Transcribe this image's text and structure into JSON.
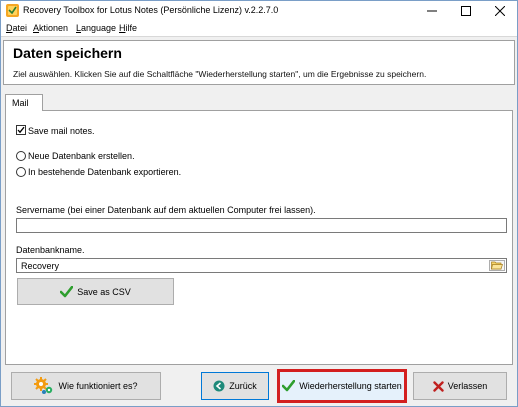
{
  "window": {
    "title": "Recovery Toolbox for Lotus Notes (Persönliche Lizenz) v.2.2.7.0",
    "controls": {
      "minimize": "–",
      "maximize": "☐",
      "close": "✕"
    }
  },
  "menu": [
    {
      "label_u": "D",
      "label_rest": "atei"
    },
    {
      "label_u": "A",
      "label_rest": "ktionen"
    },
    {
      "label_u": "L",
      "label_rest": "anguage"
    },
    {
      "label_u": "H",
      "label_rest": "ilfe"
    }
  ],
  "header": {
    "title": "Daten speichern",
    "subtitle": "Ziel auswählen. Klicken Sie auf die Schaltfläche \"Wiederherstellung starten\", um die Ergebnisse zu speichern."
  },
  "tabs": [
    {
      "label": "Mail"
    }
  ],
  "form": {
    "save_mail_notes": {
      "label": "Save mail notes.",
      "checked": true
    },
    "radio_new_db": {
      "label": "Neue Datenbank erstellen.",
      "selected": false
    },
    "radio_existing_db": {
      "label": "In bestehende Datenbank exportieren.",
      "selected": false
    },
    "servername_label": "Servername (bei einer Datenbank auf dem aktuellen Computer frei lassen).",
    "servername_value": "",
    "dbname_label": "Datenbankname.",
    "dbname_value": "Recovery",
    "save_csv_label": "Save as CSV"
  },
  "footer": {
    "help_label": "Wie funktioniert es?",
    "back_label": "Zurück",
    "start_label": "Wiederherstellung starten",
    "exit_label": "Verlassen"
  },
  "colors": {
    "accent_red": "#d31f1f",
    "check_green": "#2e9e2e",
    "back_teal": "#1e8a7a",
    "exit_red": "#c0201f"
  }
}
